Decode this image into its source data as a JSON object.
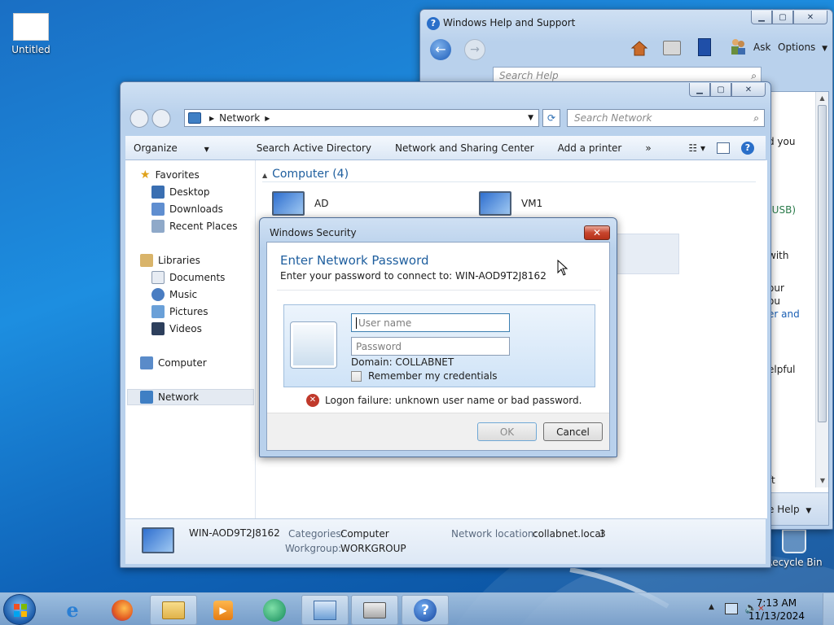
{
  "desktop": {
    "icons": [
      {
        "label": "Untitled"
      },
      {
        "label": "Recycle Bin"
      }
    ]
  },
  "help_window": {
    "title": "Windows Help and Support",
    "ask_label": "Ask",
    "options_label": "Options",
    "search_placeholder": "Search Help",
    "fragments": [
      "d you",
      "(USB)",
      "with",
      "our",
      "ou",
      "er and",
      "elpful",
      "ft"
    ],
    "help_footer": "e Help"
  },
  "explorer": {
    "breadcrumb": "Network",
    "search_placeholder": "Search Network",
    "toolbar": {
      "organize": "Organize",
      "search_ad": "Search Active Directory",
      "network_sharing": "Network and Sharing Center",
      "add_printer": "Add a printer",
      "more": "»"
    },
    "nav": {
      "favorites": "Favorites",
      "desktop": "Desktop",
      "downloads": "Downloads",
      "recent_places": "Recent Places",
      "libraries": "Libraries",
      "documents": "Documents",
      "music": "Music",
      "pictures": "Pictures",
      "videos": "Videos",
      "computer": "Computer",
      "network": "Network"
    },
    "group_header": "Computer (4)",
    "items": [
      "AD",
      "VM1"
    ],
    "details": {
      "name": "WIN-AOD9T2J8162",
      "categories_label": "Categories:",
      "categories_value": "Computer",
      "workgroup_label": "Workgroup:",
      "workgroup_value": "WORKGROUP",
      "location_label": "Network location:",
      "location_value": "collabnet.local",
      "location_count": "3"
    }
  },
  "dialog": {
    "title": "Windows Security",
    "heading": "Enter Network Password",
    "subheading": "Enter your password to connect to: WIN-AOD9T2J8162",
    "username_placeholder": "User name",
    "password_placeholder": "Password",
    "domain": "Domain: COLLABNET",
    "remember": "Remember my credentials",
    "error": "Logon failure: unknown user name or bad password.",
    "ok": "OK",
    "cancel": "Cancel",
    "close": "✕"
  },
  "taskbar": {
    "time": "7:13 AM",
    "date": "11/13/2024"
  },
  "colors": {
    "heading_blue": "#1e5e9e",
    "accent": "#1a6fc4",
    "error_red": "#c0392b"
  }
}
